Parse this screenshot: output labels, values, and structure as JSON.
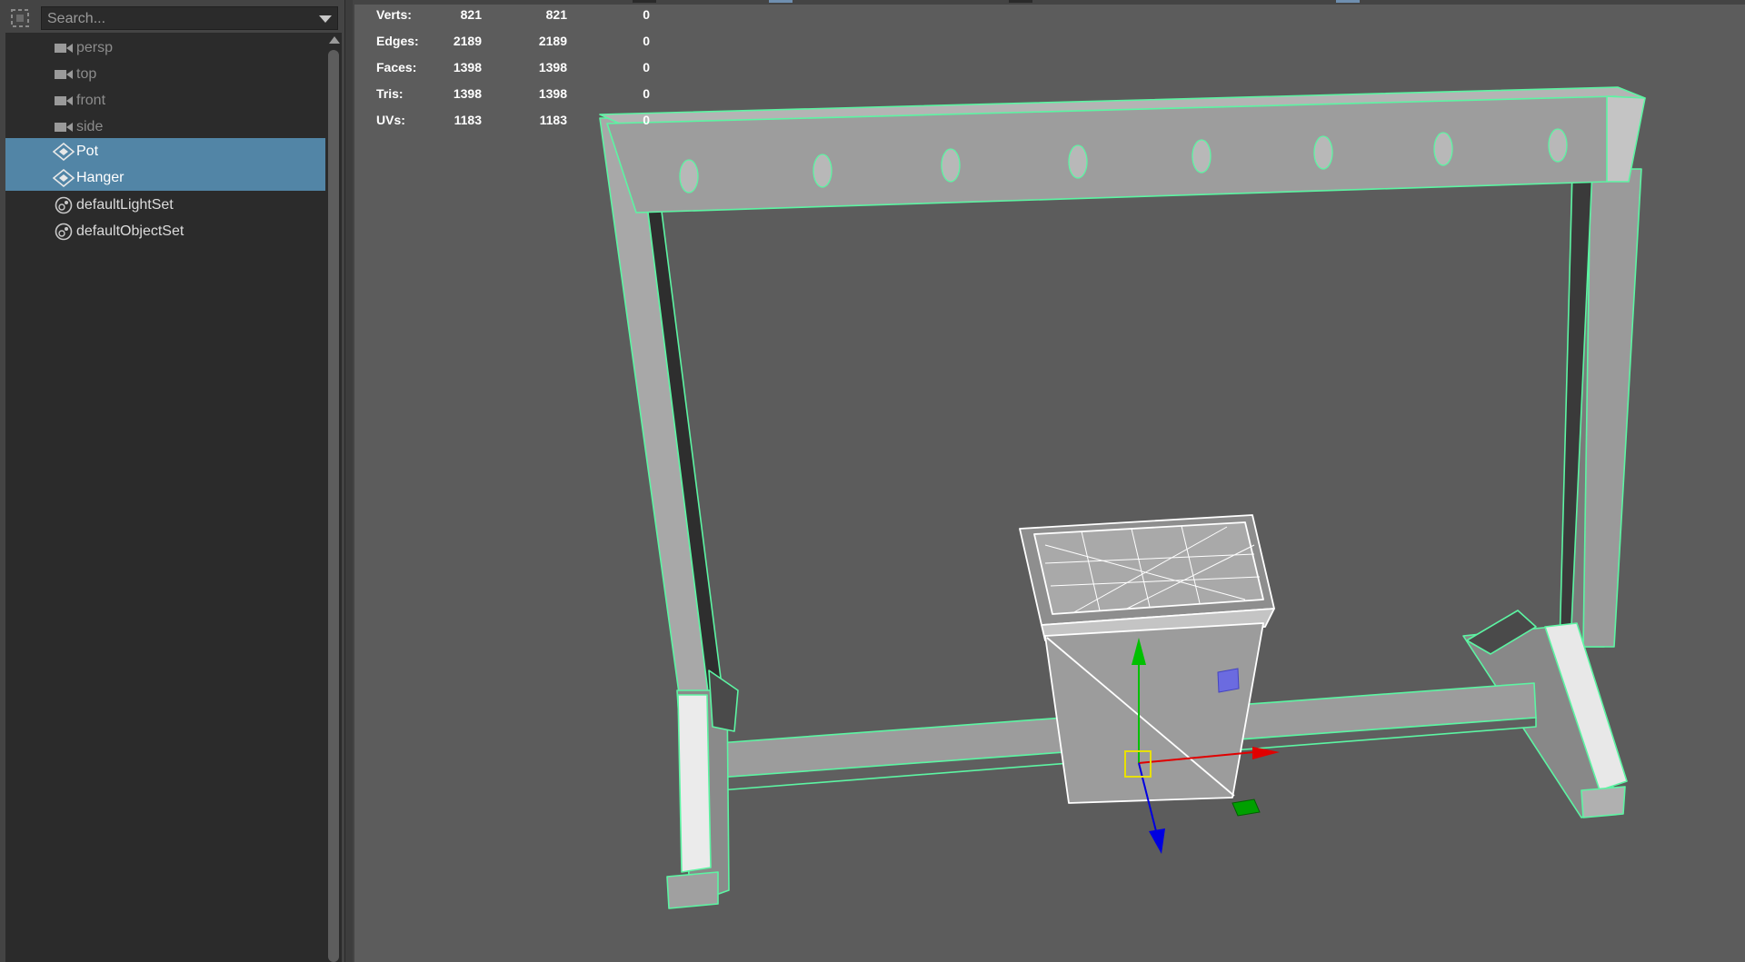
{
  "outliner": {
    "search_placeholder": "Search...",
    "items": [
      {
        "label": "persp",
        "icon": "camera-icon",
        "state": "dim"
      },
      {
        "label": "top",
        "icon": "camera-icon",
        "state": "dim"
      },
      {
        "label": "front",
        "icon": "camera-icon",
        "state": "dim"
      },
      {
        "label": "side",
        "icon": "camera-icon",
        "state": "dim"
      },
      {
        "label": "Pot",
        "icon": "mesh-transform-icon",
        "state": "selected"
      },
      {
        "label": "Hanger",
        "icon": "mesh-transform-icon",
        "state": "selected"
      },
      {
        "label": "defaultLightSet",
        "icon": "set-icon",
        "state": "normal"
      },
      {
        "label": "defaultObjectSet",
        "icon": "set-icon",
        "state": "normal"
      }
    ]
  },
  "hud": {
    "rows": [
      {
        "name": "Verts:",
        "v1": "821",
        "v2": "821",
        "v3": "0"
      },
      {
        "name": "Edges:",
        "v1": "2189",
        "v2": "2189",
        "v3": "0"
      },
      {
        "name": "Faces:",
        "v1": "1398",
        "v2": "1398",
        "v3": "0"
      },
      {
        "name": "Tris:",
        "v1": "1398",
        "v2": "1398",
        "v3": "0"
      },
      {
        "name": "UVs:",
        "v1": "1183",
        "v2": "1183",
        "v3": "0"
      }
    ]
  },
  "colors": {
    "selection": "#5285a6",
    "wire_hilite": "#5cf5a3",
    "viewport_bg": "#5c5c5c",
    "axis_x": "#e00000",
    "axis_y": "#00c000",
    "axis_z": "#0000e0",
    "pivot": "#e8e000"
  }
}
